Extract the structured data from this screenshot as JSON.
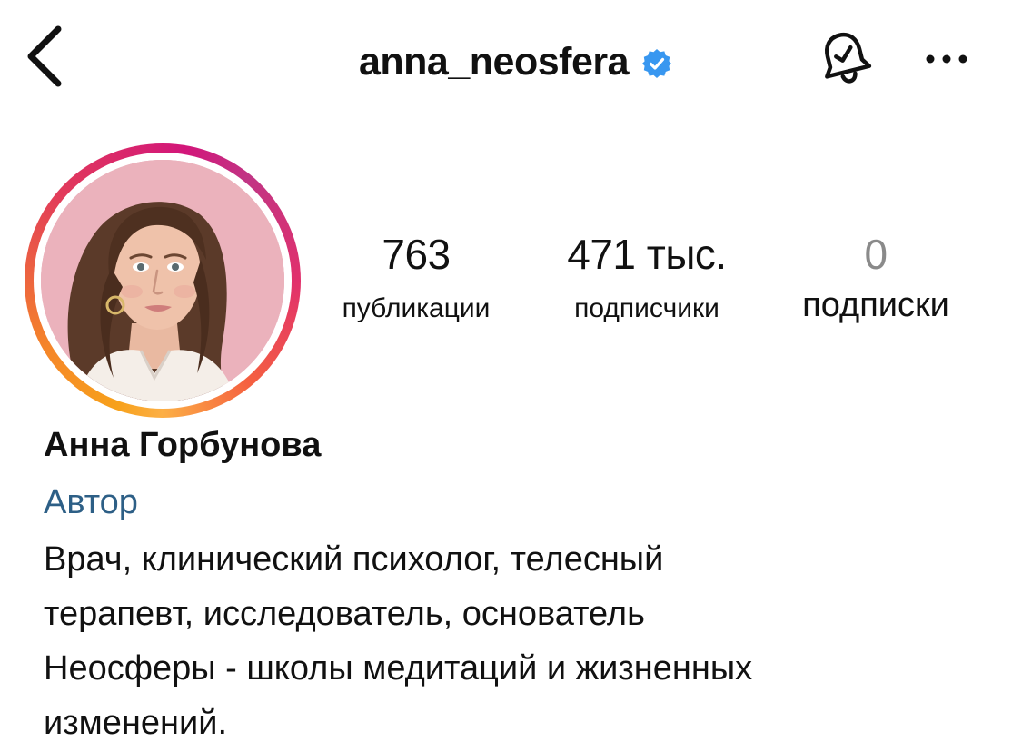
{
  "header": {
    "username": "anna_neosfera",
    "verified": true,
    "verified_color": "#3897f0",
    "icons": [
      "back-chevron-icon",
      "verified-badge-icon",
      "bell-icon",
      "more-icon"
    ]
  },
  "profile": {
    "avatar": {
      "ring_colors": [
        "#fcaf45",
        "#f56040",
        "#e1306c",
        "#c13584"
      ],
      "photo_background": "#e6a8b3"
    },
    "stats": {
      "posts": {
        "value": "763",
        "label": "публикации"
      },
      "followers": {
        "value": "471 тыс.",
        "label": "подписчики"
      },
      "following": {
        "value": "0",
        "label": "подписки"
      }
    },
    "full_name": "Анна Горбунова",
    "category": "Автор",
    "category_color": "#2d5f86",
    "bio_lines": [
      "Врач, клинический психолог, телесный",
      "терапевт, исследователь, основатель",
      "Неосферы - школы медитаций и жизненных",
      "изменений."
    ]
  }
}
